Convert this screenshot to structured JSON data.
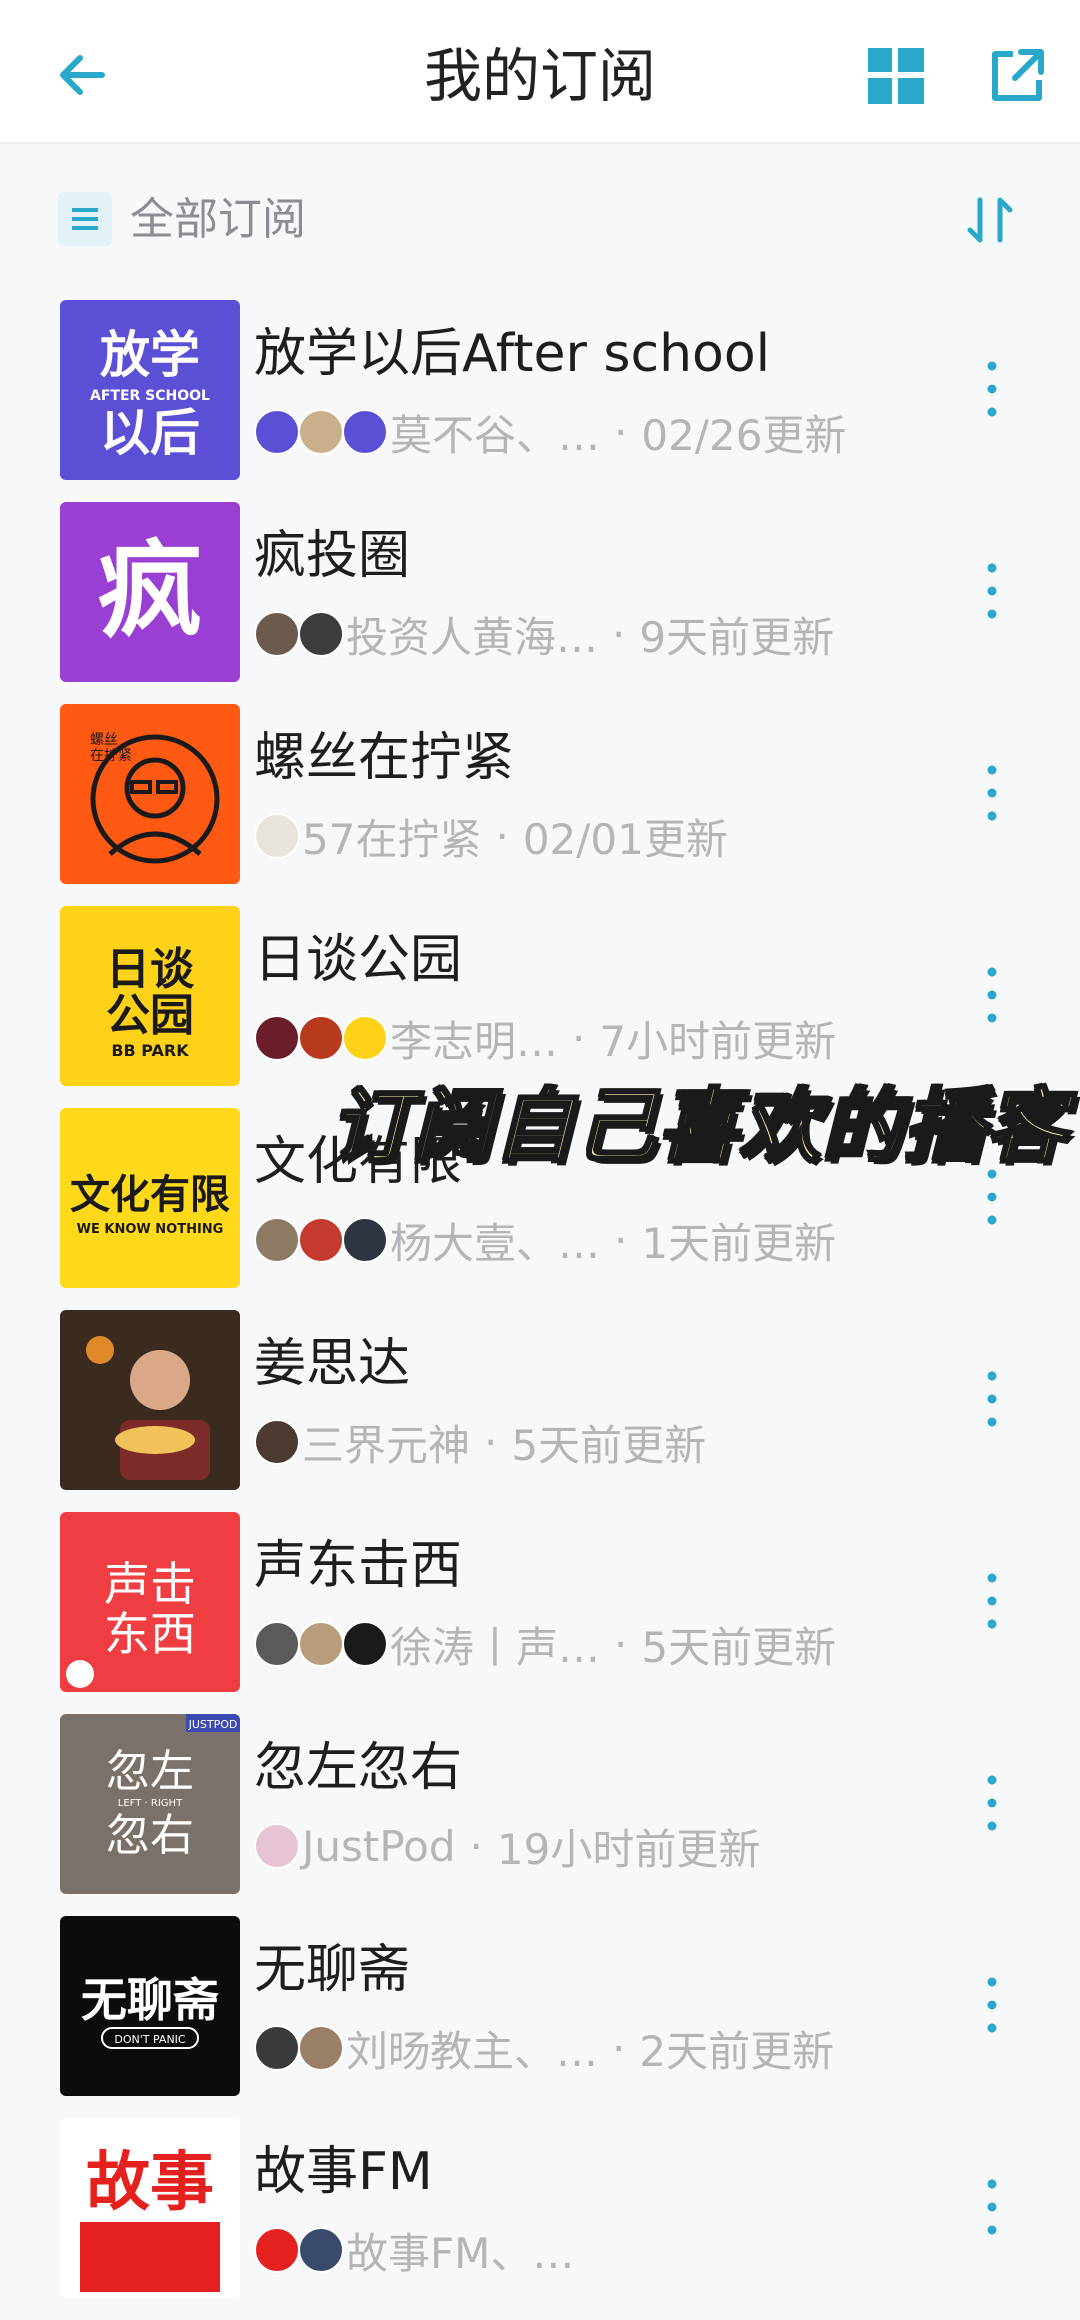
{
  "header": {
    "title": "我的订阅",
    "back_icon": "back-arrow-icon",
    "grid_icon": "grid-view-icon",
    "share_icon": "share-icon",
    "accent": "#2aa8c9"
  },
  "filter": {
    "label": "全部订阅",
    "filter_icon": "list-icon",
    "sort_icon": "sort-icon"
  },
  "caption": "订阅自己喜欢的播客",
  "podcasts": [
    {
      "title": "放学以后After school",
      "hosts": "莫不谷、…",
      "updated": "02/26更新",
      "cover_color": "#5b4fd6",
      "cover_text": "放学以后"
    },
    {
      "title": "疯投圈",
      "hosts": "投资人黄海…",
      "updated": "9天前更新",
      "cover_color": "#9a3fd4",
      "cover_text": "疯"
    },
    {
      "title": "螺丝在拧紧",
      "hosts": "57在拧紧",
      "updated": "02/01更新",
      "cover_color": "#ff5a14",
      "cover_text": "螺丝在拧紧"
    },
    {
      "title": "日谈公园",
      "hosts": "李志明…",
      "updated": "7小时前更新",
      "cover_color": "#ffd21a",
      "cover_text": "日谈公园"
    },
    {
      "title": "文化有限",
      "hosts": "杨大壹、…",
      "updated": "1天前更新",
      "cover_color": "#ffd91a",
      "cover_text": "文化有限"
    },
    {
      "title": "姜思达",
      "hosts": "三界元神",
      "updated": "5天前更新",
      "cover_color": "#3a2b1e",
      "cover_text": ""
    },
    {
      "title": "声东击西",
      "hosts": "徐涛丨声…",
      "updated": "5天前更新",
      "cover_color": "#ef3e42",
      "cover_text": "声东击西"
    },
    {
      "title": "忽左忽右",
      "hosts": "JustPod",
      "updated": "19小时前更新",
      "cover_color": "#7a716a",
      "cover_text": "忽左忽右"
    },
    {
      "title": "无聊斋",
      "hosts": "刘旸教主、…",
      "updated": "2天前更新",
      "cover_color": "#0c0c0c",
      "cover_text": "无聊斋"
    },
    {
      "title": "故事FM",
      "hosts": "故事FM、…",
      "updated": "",
      "cover_color": "#e5211f",
      "cover_text": "故事"
    }
  ]
}
